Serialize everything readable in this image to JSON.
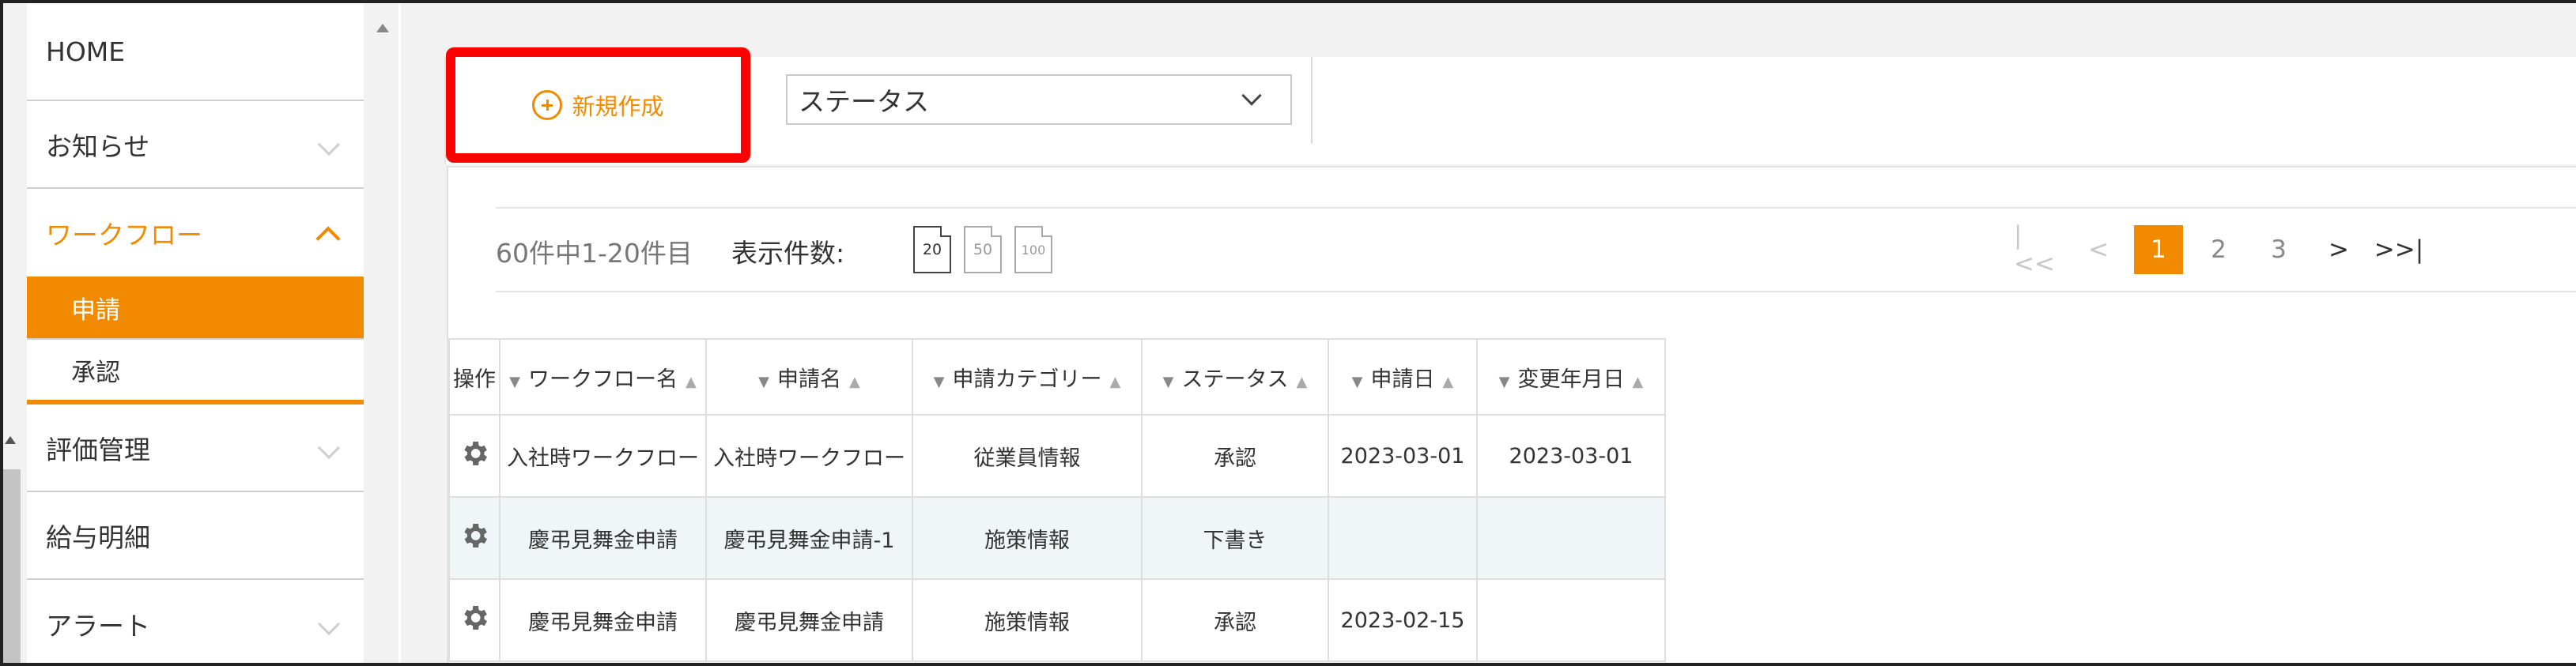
{
  "sidebar": {
    "items": [
      {
        "label": "HOME"
      },
      {
        "label": "お知らせ"
      },
      {
        "label": "ワークフロー"
      },
      {
        "label": "評価管理"
      },
      {
        "label": "給与明細"
      },
      {
        "label": "アラート"
      }
    ],
    "workflow_sub": [
      {
        "label": "申請",
        "active": true
      },
      {
        "label": "承認",
        "active": false
      }
    ]
  },
  "toolbar": {
    "new_label": "新規作成",
    "status_value": "ステータス"
  },
  "pager": {
    "count_text": "60件中1-20件目",
    "perpage_label": "表示件数:",
    "perpage_options": [
      "20",
      "50",
      "100"
    ],
    "first": "|<<",
    "prev": "<",
    "pages": [
      "1",
      "2",
      "3"
    ],
    "current_page": "1",
    "next": ">",
    "last": ">>|"
  },
  "table": {
    "headers": [
      "操作",
      "ワークフロー名",
      "申請名",
      "申請カテゴリー",
      "ステータス",
      "申請日",
      "変更年月日"
    ],
    "rows": [
      [
        "",
        "入社時ワークフロー",
        "入社時ワークフロー",
        "従業員情報",
        "承認",
        "2023-03-01",
        "2023-03-01"
      ],
      [
        "",
        "慶弔見舞金申請",
        "慶弔見舞金申請-1",
        "施策情報",
        "下書き",
        "",
        ""
      ],
      [
        "",
        "慶弔見舞金申請",
        "慶弔見舞金申請",
        "施策情報",
        "承認",
        "2023-02-15",
        ""
      ]
    ]
  },
  "colors": {
    "accent": "#f28a00",
    "highlight_border": "#ff0000"
  }
}
